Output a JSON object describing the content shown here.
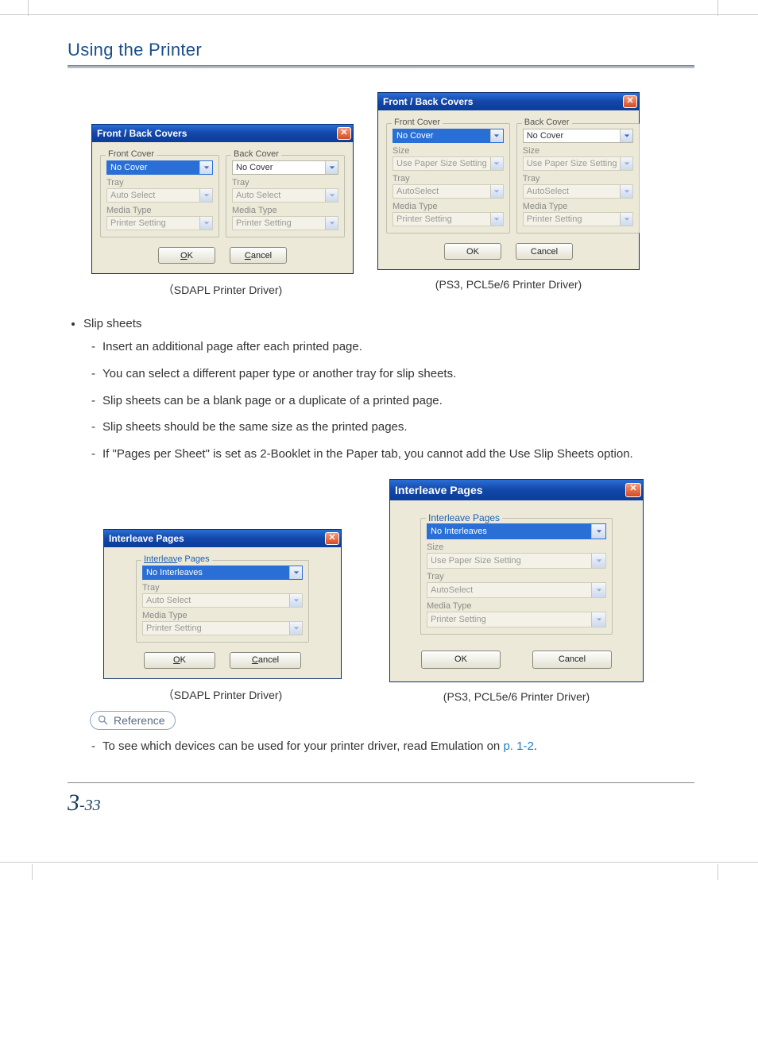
{
  "page": {
    "heading": "Using the Printer",
    "page_number_chapter": "3",
    "page_number_sep": "-",
    "page_number_page": "33"
  },
  "captions": {
    "sdapl": "（SDAPL Printer Driver)",
    "ps3": "(PS3, PCL5e/6 Printer Driver)"
  },
  "frontback_a": {
    "title": "Front / Back Covers",
    "front_legend": "Front Cover",
    "back_legend": "Back Cover",
    "cover_value": "No Cover",
    "tray_label": "Tray",
    "tray_value": "Auto Select",
    "media_label": "Media Type",
    "media_value": "Printer Setting",
    "ok": "OK",
    "cancel": "Cancel"
  },
  "frontback_b": {
    "title": "Front / Back Covers",
    "front_legend": "Front Cover",
    "back_legend": "Back Cover",
    "cover_value": "No Cover",
    "size_label": "Size",
    "size_value": "Use Paper Size Setting",
    "tray_label": "Tray",
    "tray_value": "AutoSelect",
    "media_label": "Media Type",
    "media_value": "Printer Setting",
    "ok": "OK",
    "cancel": "Cancel"
  },
  "bullets": {
    "slip": "Slip sheets",
    "items": [
      "Insert an additional page after each printed page.",
      "You can select a different paper type or another tray for slip sheets.",
      "Slip sheets can be a blank page or a duplicate of a printed page.",
      "Slip sheets should be the same size as the printed pages.",
      "If \"Pages per Sheet\" is set as 2-Booklet in the Paper tab, you cannot add the Use Slip Sheets option."
    ]
  },
  "inter_a": {
    "title": "Interleave Pages",
    "legend": "Interleave Pages",
    "value": "No Interleaves",
    "tray_label": "Tray",
    "tray_value": "Auto Select",
    "media_label": "Media Type",
    "media_value": "Printer Setting",
    "ok": "OK",
    "cancel": "Cancel"
  },
  "inter_b": {
    "title": "Interleave Pages",
    "legend": "Interleave Pages",
    "value": "No Interleaves",
    "size_label": "Size",
    "size_value": "Use Paper Size Setting",
    "tray_label": "Tray",
    "tray_value": "AutoSelect",
    "media_label": "Media Type",
    "media_value": "Printer Setting",
    "ok": "OK",
    "cancel": "Cancel"
  },
  "reference": {
    "label": "Reference",
    "text_prefix": "To see which devices can be used for your printer driver, read Emulation on ",
    "link": "p. 1-2",
    "text_suffix": "."
  }
}
